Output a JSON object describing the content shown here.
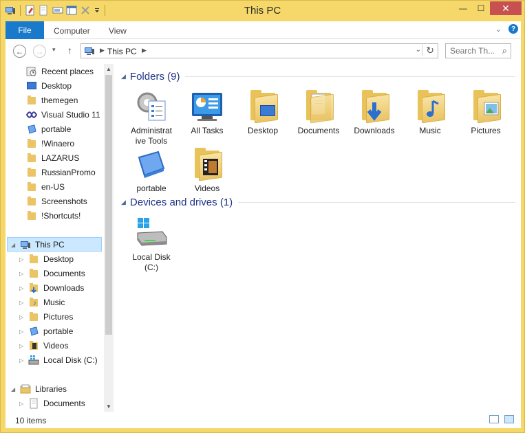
{
  "window": {
    "title": "This PC"
  },
  "ribbon": {
    "file": "File",
    "tabs": [
      "Computer",
      "View"
    ],
    "help": "?"
  },
  "nav": {
    "back": "←",
    "forward": "→",
    "recent": "▾",
    "up": "↑"
  },
  "address": {
    "crumb": "This PC",
    "dropdown": "⌄",
    "refresh": "↻"
  },
  "search": {
    "placeholder": "Search Th...",
    "icon": "🔍"
  },
  "navpane": {
    "quick": [
      "Recent places",
      "Desktop",
      "themegen",
      "Visual Studio 11",
      "portable",
      "!Winaero",
      "LAZARUS",
      "RussianPromo",
      "en-US",
      "Screenshots",
      "!Shortcuts!"
    ],
    "this_pc": "This PC",
    "this_pc_children": [
      "Desktop",
      "Documents",
      "Downloads",
      "Music",
      "Pictures",
      "portable",
      "Videos",
      "Local Disk (C:)"
    ],
    "libraries": "Libraries",
    "libraries_children": [
      "Documents"
    ]
  },
  "content": {
    "folders_header": "Folders (9)",
    "folders": [
      {
        "label1": "Administrat",
        "label2": "ive Tools",
        "icon": "admin-tools-icon"
      },
      {
        "label1": "All Tasks",
        "label2": "",
        "icon": "control-panel-icon"
      },
      {
        "label1": "Desktop",
        "label2": "",
        "icon": "folder-icon"
      },
      {
        "label1": "Documents",
        "label2": "",
        "icon": "folder-icon"
      },
      {
        "label1": "Downloads",
        "label2": "",
        "icon": "folder-icon"
      },
      {
        "label1": "Music",
        "label2": "",
        "icon": "folder-icon"
      },
      {
        "label1": "Pictures",
        "label2": "",
        "icon": "folder-icon"
      },
      {
        "label1": "portable",
        "label2": "",
        "icon": "portable-icon"
      },
      {
        "label1": "Videos",
        "label2": "",
        "icon": "folder-icon"
      }
    ],
    "drives_header": "Devices and drives (1)",
    "drives": [
      {
        "label1": "Local Disk",
        "label2": "(C:)",
        "icon": "hard-drive-icon"
      }
    ]
  },
  "status": {
    "count": "10 items"
  },
  "colors": {
    "accent": "#1979ca",
    "frame": "#f5d869",
    "selection": "#cce8ff",
    "group_title": "#1e3287"
  }
}
